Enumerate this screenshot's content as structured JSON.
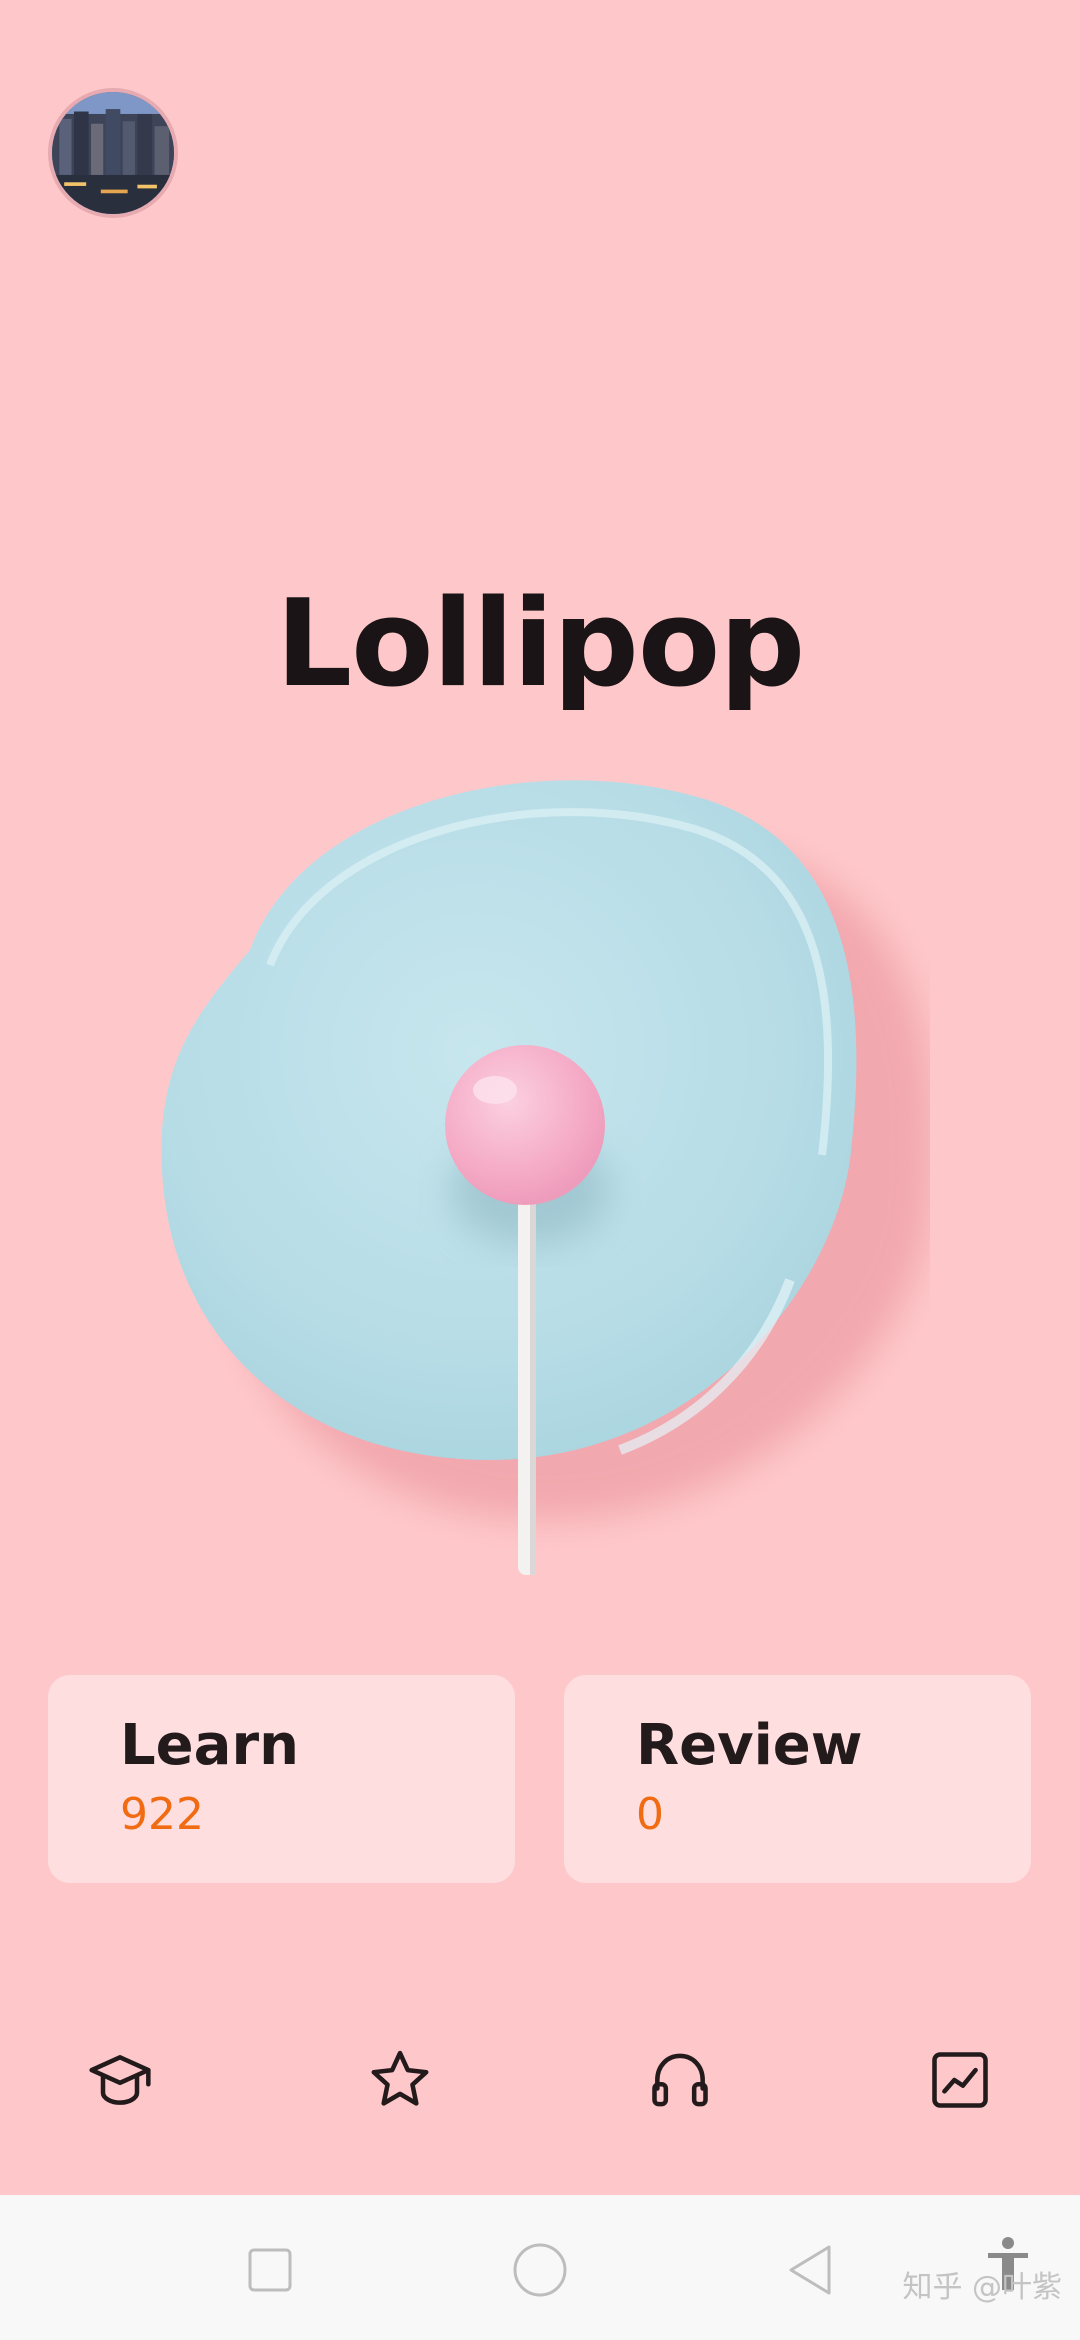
{
  "header": {
    "avatar_alt": "avatar"
  },
  "main": {
    "title": "Lollipop",
    "hero_image": "lollipop-on-blue-plate"
  },
  "cards": [
    {
      "label": "Learn",
      "count": "922"
    },
    {
      "label": "Review",
      "count": "0"
    }
  ],
  "bottom_nav": {
    "items": [
      {
        "icon": "graduation-cap-icon"
      },
      {
        "icon": "star-icon"
      },
      {
        "icon": "headphones-icon"
      },
      {
        "icon": "chart-icon"
      }
    ]
  },
  "system_nav": {
    "items": [
      {
        "icon": "recents-square-icon"
      },
      {
        "icon": "home-circle-icon"
      },
      {
        "icon": "back-triangle-icon"
      }
    ]
  },
  "watermark": {
    "text": "知乎 @叶紫"
  },
  "colors": {
    "background": "#fec8ca",
    "accent_count": "#f06b12",
    "text_dark": "#231a1c",
    "plate": "#b9dfe8",
    "candy": "#f7b4cc"
  }
}
